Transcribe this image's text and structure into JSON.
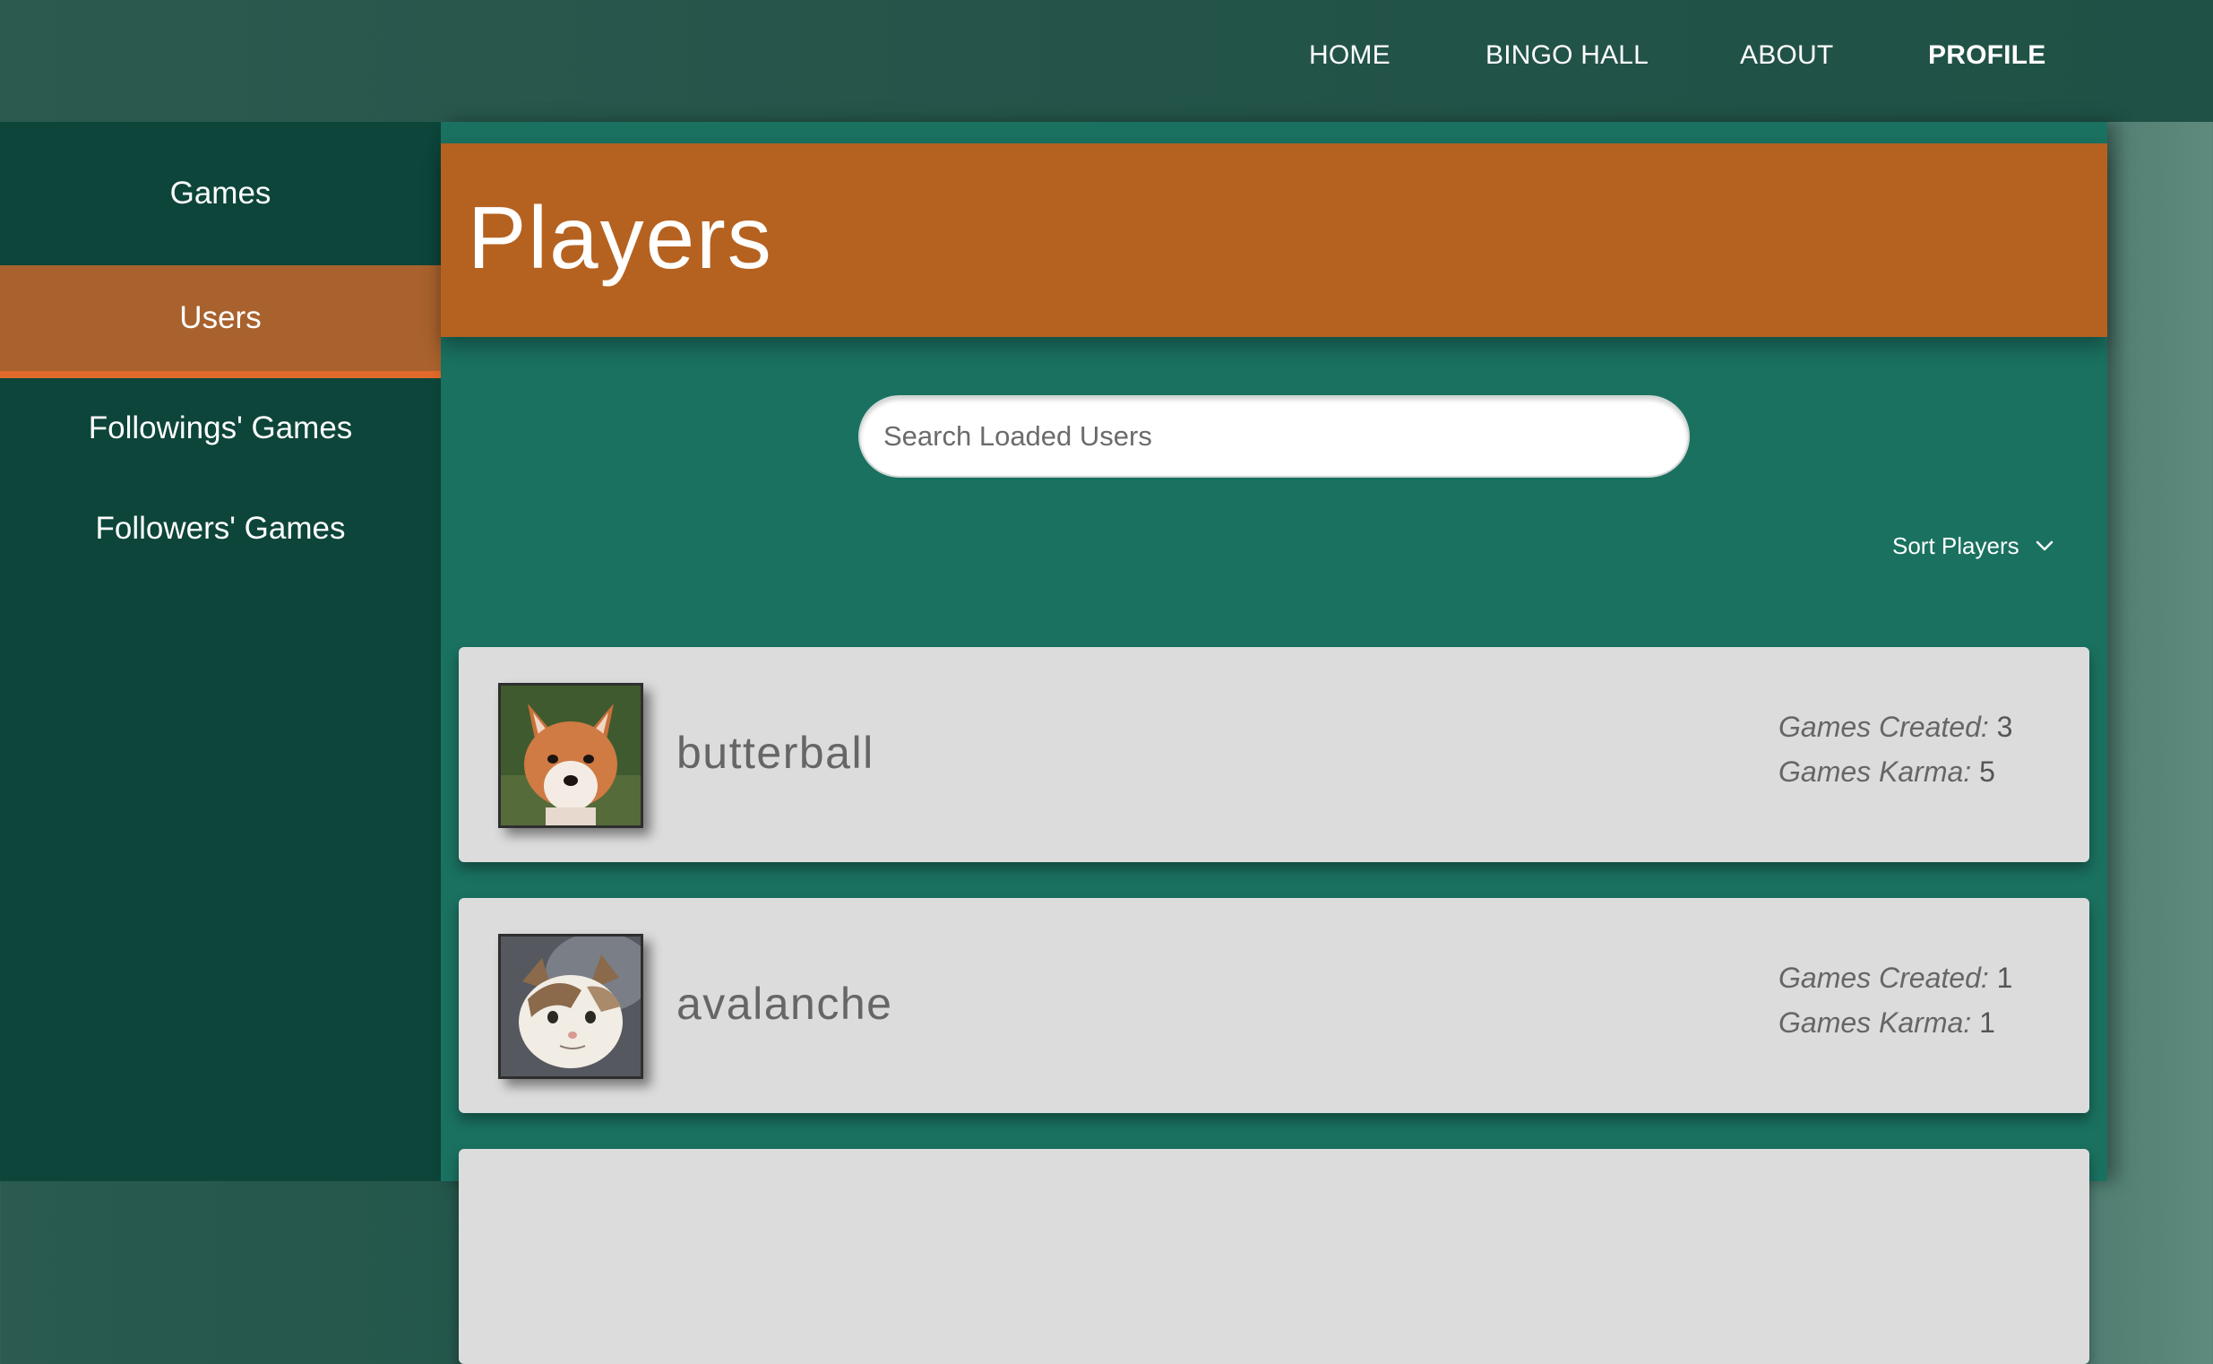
{
  "nav": {
    "home": "HOME",
    "bingo_hall": "BINGO HALL",
    "about": "ABOUT",
    "profile": "PROFILE"
  },
  "sidebar": {
    "items": [
      {
        "label": "Games",
        "active": false
      },
      {
        "label": "Users",
        "active": true
      },
      {
        "label": "Followings' Games",
        "active": false
      },
      {
        "label": "Followers' Games",
        "active": false
      }
    ]
  },
  "main": {
    "title": "Players",
    "search": {
      "placeholder": "Search Loaded Users",
      "value": ""
    },
    "sort_label": "Sort Players",
    "players": [
      {
        "username": "butterball",
        "avatar": "fox-avatar",
        "games_created_label": "Games Created:",
        "games_created": "3",
        "games_karma_label": "Games Karma:",
        "games_karma": "5"
      },
      {
        "username": "avalanche",
        "avatar": "cat-avatar",
        "games_created_label": "Games Created:",
        "games_created": "1",
        "games_karma_label": "Games Karma:",
        "games_karma": "1"
      }
    ]
  },
  "colors": {
    "topbar": "#245449",
    "sidebar": "#0d453a",
    "sidebar_active": "#a9622d",
    "sidebar_active_accent": "#e1692a",
    "panel": "#1a7160",
    "header_band": "#b56221",
    "card": "#dcdcdc"
  }
}
